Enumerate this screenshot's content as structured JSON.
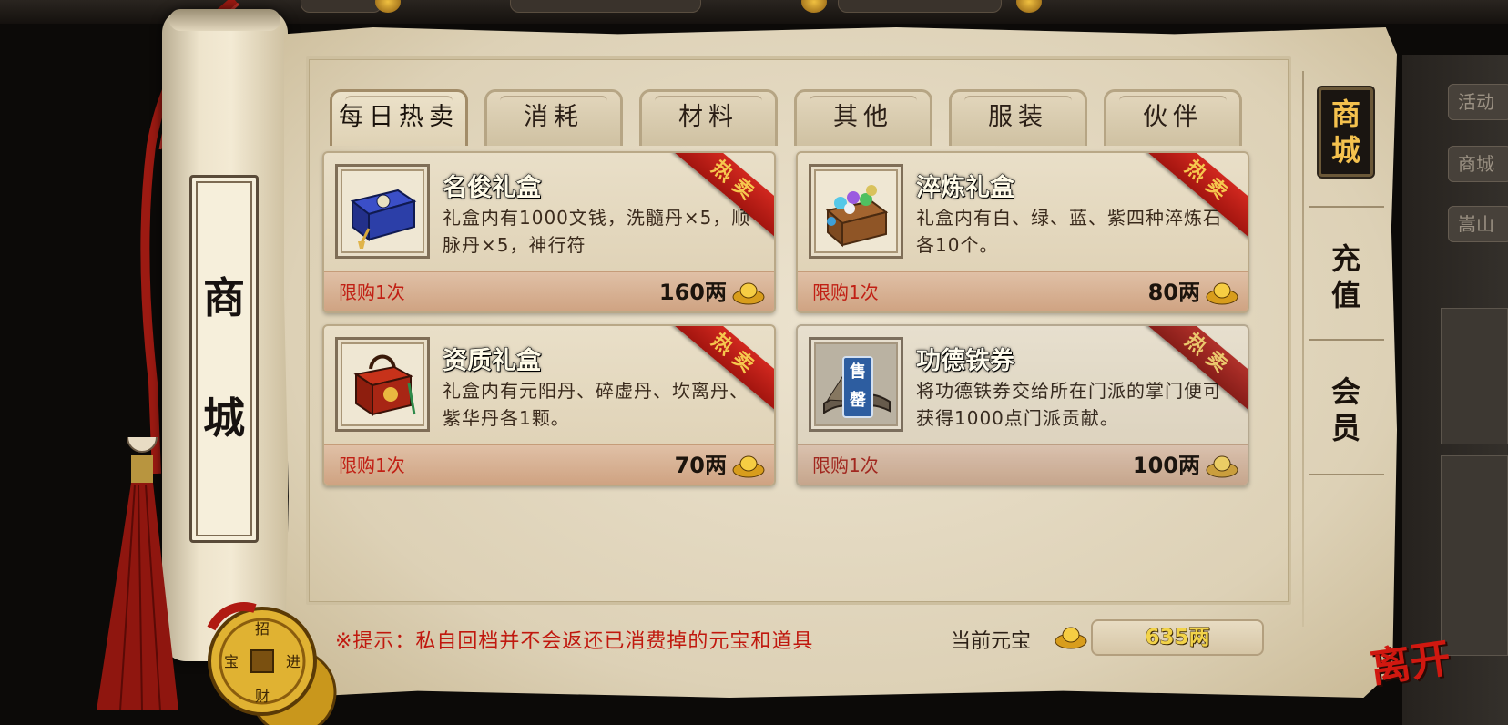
{
  "scroll_title": [
    "商",
    "城"
  ],
  "tabs": [
    {
      "label": "每日热卖",
      "active": true
    },
    {
      "label": "消耗",
      "active": false
    },
    {
      "label": "材料",
      "active": false
    },
    {
      "label": "其他",
      "active": false
    },
    {
      "label": "服装",
      "active": false
    },
    {
      "label": "伙伴",
      "active": false
    }
  ],
  "items": [
    {
      "name": "名俊礼盒",
      "desc": "礼盒内有1000文钱，洗髓丹×5，顺脉丹×5，神行符",
      "limit": "限购1次",
      "price": "160两",
      "ribbon": "热卖",
      "icon": "blue-gift-box-icon"
    },
    {
      "name": "淬炼礼盒",
      "desc": "礼盒内有白、绿、蓝、紫四种淬炼石各10个。",
      "limit": "限购1次",
      "price": "80两",
      "ribbon": "热卖",
      "icon": "gem-chest-icon"
    },
    {
      "name": "资质礼盒",
      "desc": "礼盒内有元阳丹、碎虚丹、坎离丹、紫华丹各1颗。",
      "limit": "限购1次",
      "price": "70两",
      "ribbon": "热卖",
      "icon": "red-lantern-box-icon"
    },
    {
      "name": "功德铁券",
      "desc": "将功德铁券交给所在门派的掌门便可获得1000点门派贡献。",
      "limit": "限购1次",
      "price": "100两",
      "ribbon": "热卖",
      "icon": "iron-voucher-icon",
      "soldout_tag": "售罄",
      "soldout": true
    }
  ],
  "side_nav": [
    {
      "label": [
        "商",
        "城"
      ],
      "active": true
    },
    {
      "label": [
        "充",
        "值"
      ],
      "active": false
    },
    {
      "label": [
        "会",
        "员"
      ],
      "active": false
    }
  ],
  "hint": "※提示：私自回档并不会返还已消费掉的元宝和道具",
  "balance": {
    "label": "当前元宝",
    "value": "635两"
  },
  "leave_label": "离开",
  "background_side": {
    "items": [
      "活动",
      "商城",
      "嵩山"
    ]
  },
  "coin_text": [
    "招",
    "财",
    "进",
    "宝"
  ],
  "colors": {
    "ribbon": "#c01f17",
    "limit_text": "#c11f14",
    "gold_text": "#f2d34a",
    "active_nav": "#f4c14e"
  }
}
